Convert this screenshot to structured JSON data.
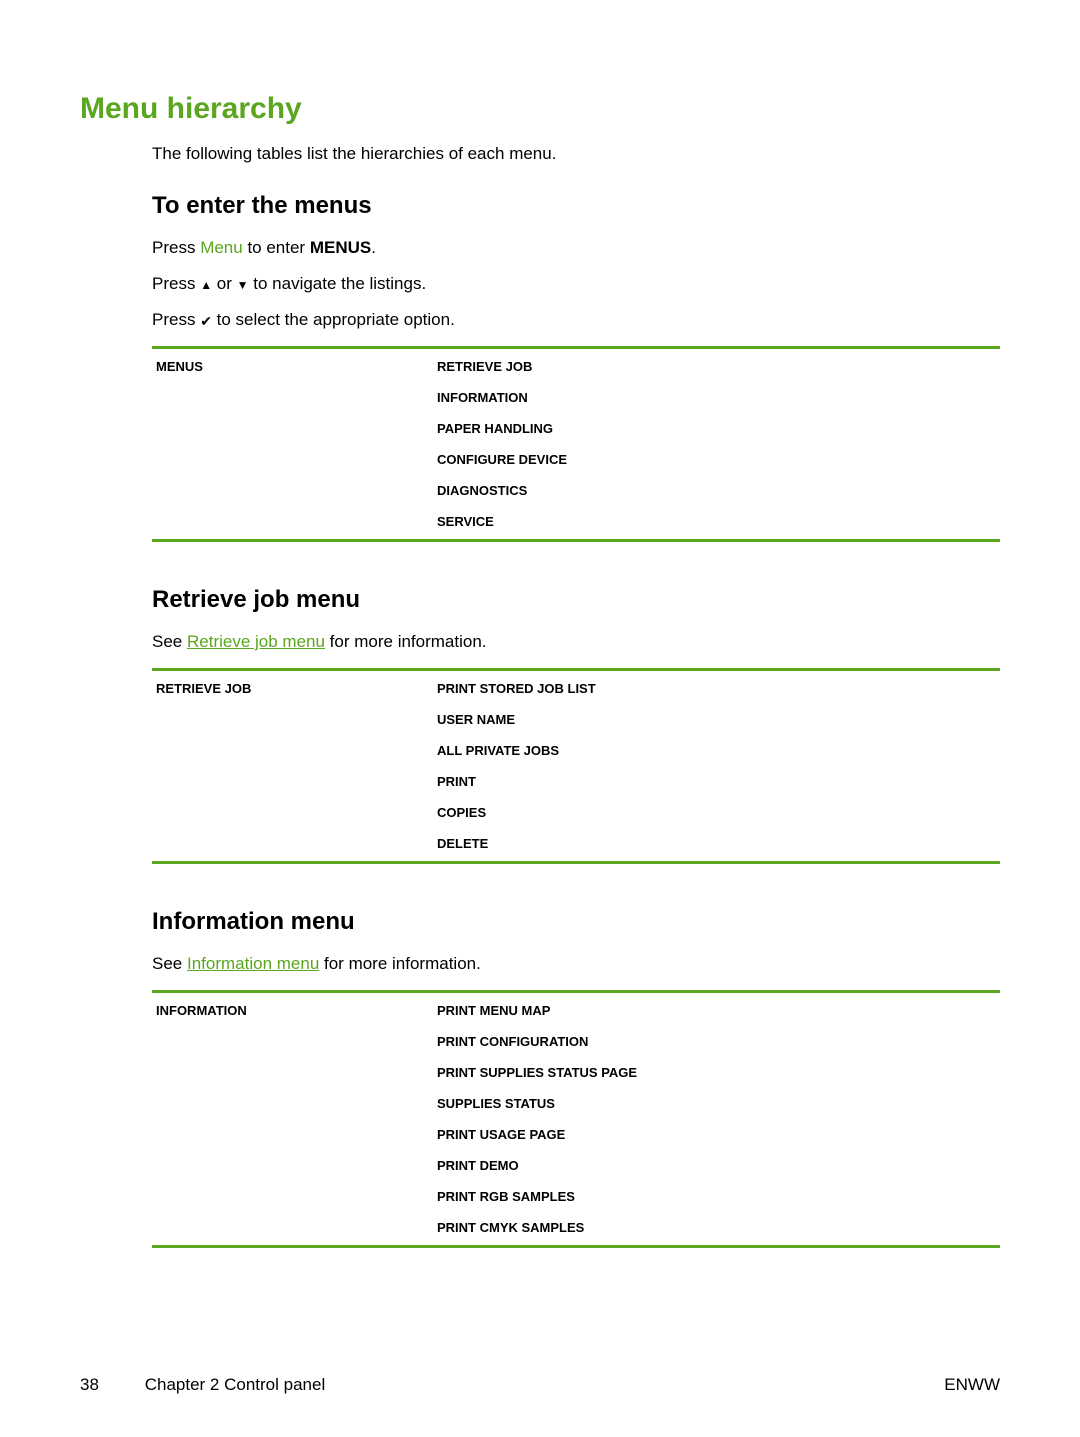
{
  "title": "Menu hierarchy",
  "intro": "The following tables list the hierarchies of each menu.",
  "enter": {
    "heading": "To enter the menus",
    "press_label": "Press ",
    "menu_word": "Menu",
    "to_enter": " to enter ",
    "menus_bold": "MENUS",
    "period": ".",
    "nav_prefix": "Press ",
    "nav_or": " or ",
    "nav_suffix": " to navigate the listings.",
    "select_prefix": "Press ",
    "select_suffix": " to select the appropriate option."
  },
  "table_menus": {
    "left": "MENUS",
    "items": [
      "RETRIEVE JOB",
      "INFORMATION",
      "PAPER HANDLING",
      "CONFIGURE DEVICE",
      "DIAGNOSTICS",
      "SERVICE"
    ]
  },
  "retrieve": {
    "heading": "Retrieve job menu",
    "see_prefix": "See ",
    "link": "Retrieve job menu",
    "see_suffix": " for more information."
  },
  "table_retrieve": {
    "left": "RETRIEVE JOB",
    "items": [
      "PRINT STORED JOB LIST",
      "USER NAME",
      "ALL PRIVATE JOBS",
      "PRINT",
      "COPIES",
      "DELETE"
    ]
  },
  "information": {
    "heading": "Information menu",
    "see_prefix": "See ",
    "link": "Information menu",
    "see_suffix": " for more information."
  },
  "table_information": {
    "left": "INFORMATION",
    "items": [
      "PRINT MENU MAP",
      "PRINT CONFIGURATION",
      "PRINT SUPPLIES STATUS PAGE",
      "SUPPLIES STATUS",
      "PRINT USAGE PAGE",
      "PRINT DEMO",
      "PRINT RGB SAMPLES",
      "PRINT CMYK SAMPLES"
    ]
  },
  "footer": {
    "page_number": "38",
    "chapter": "Chapter 2   Control panel",
    "right": "ENWW"
  },
  "icons": {
    "up": "▲",
    "down": "▼",
    "check": "✔"
  }
}
